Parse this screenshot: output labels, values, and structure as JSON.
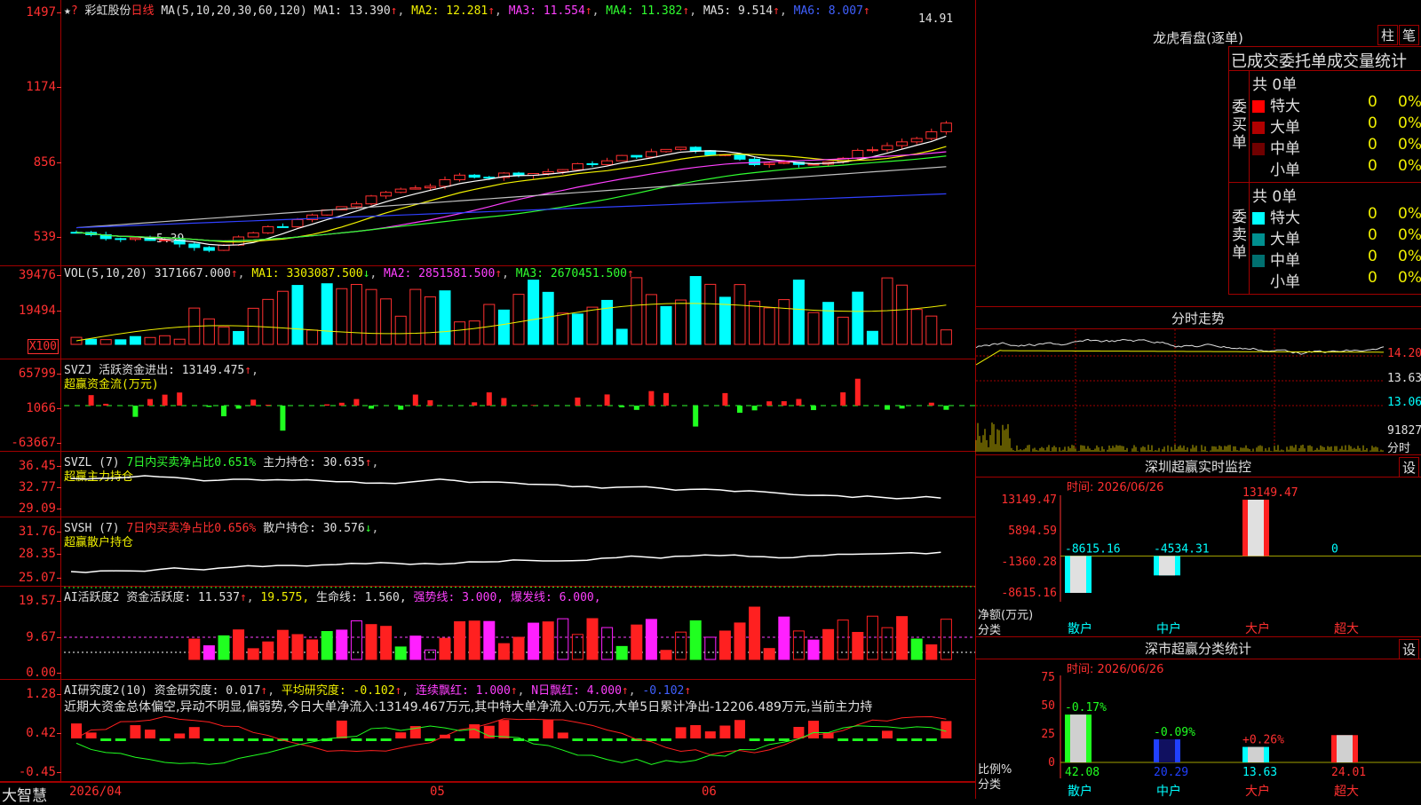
{
  "stock": {
    "name": "彩虹股份",
    "period": "日线",
    "star": "★",
    "mark": "?"
  },
  "ma_line": {
    "label": "MA(5,10,20,30,60,120)",
    "ma1": "MA1: 13.390",
    "ma2": "MA2: 12.281",
    "ma3": "MA3: 11.554",
    "ma4": "MA4: 11.382",
    "ma5": "MA5: 9.514",
    "ma6": "MA6: 8.007",
    "arrow": "↑"
  },
  "price_axis": [
    "1497",
    "1174",
    "856",
    "539"
  ],
  "price_labels": {
    "high": "14.91",
    "low": "5.39"
  },
  "vol": {
    "label": "VOL(5,10,20)",
    "value": "3171667.000",
    "ma1": "MA1: 3303087.500",
    "ma2": "MA2: 2851581.500",
    "ma3": "MA3: 2670451.500",
    "axis": [
      "39476",
      "19494"
    ],
    "unit": "X100"
  },
  "svzj": {
    "label": "SVZJ",
    "title": "活跃资金进出: 13149.475",
    "sub": "超赢资金流(万元)",
    "axis": [
      "65799",
      "1066",
      "-63667"
    ]
  },
  "svzl": {
    "label": "SVZL (7)",
    "p1": "7日内买卖净占比0.651%",
    "p2": "主力持仓: 30.635",
    "sub": "超赢主力持仓",
    "axis": [
      "36.45",
      "32.77",
      "29.09"
    ]
  },
  "svsh": {
    "label": "SVSH (7)",
    "p1": "7日内买卖净占比0.656%",
    "p2": "散户持仓: 30.576",
    "sub": "超赢散户持仓",
    "axis": [
      "31.76",
      "28.35",
      "25.07"
    ]
  },
  "ai1": {
    "label": "AI活跃度2",
    "p1": "资金活跃度: 11.537",
    "p2": "19.575,",
    "p3": "生命线: 1.560,",
    "p4": "强势线: 3.000,",
    "p5": "爆发线: 6.000,",
    "axis": [
      "19.57",
      "9.67",
      "0.00"
    ]
  },
  "ai2": {
    "label": "AI研究度2(10)",
    "p1": "资金研究度: 0.017",
    "p2": "平均研究度: -0.102",
    "p3": "连续飘红: 1.000",
    "p4": "N日飘红: 4.000",
    "p5": "-0.102",
    "text": "近期大资金总体偏空,异动不明显,偏弱势,今日大单净流入:13149.467万元,其中特大单净流入:0万元,大单5日累计净出-12206.489万元,当前主力持",
    "axis": [
      "1.28",
      "0.42",
      "-0.45"
    ]
  },
  "footer": {
    "brand": "大智慧",
    "dates": [
      "2026/04",
      "05",
      "06"
    ]
  },
  "lhb": {
    "title": "龙虎看盘(逐单)",
    "btn1": "柱",
    "btn2": "笔",
    "header": "已成交委托单成交量统计",
    "buy": {
      "side": "委买单",
      "total": "共 0单",
      "rows": [
        {
          "name": "特大",
          "v": "0",
          "p": "0%",
          "color": "#ff0000"
        },
        {
          "name": "大单",
          "v": "0",
          "p": "0%",
          "color": "#b00000"
        },
        {
          "name": "中单",
          "v": "0",
          "p": "0%",
          "color": "#700000"
        },
        {
          "name": "小单",
          "v": "0",
          "p": "0%",
          "color": ""
        }
      ]
    },
    "sell": {
      "side": "委卖单",
      "total": "共 0单",
      "rows": [
        {
          "name": "特大",
          "v": "0",
          "p": "0%",
          "color": "#00ffff"
        },
        {
          "name": "大单",
          "v": "0",
          "p": "0%",
          "color": "#009090"
        },
        {
          "name": "中单",
          "v": "0",
          "p": "0%",
          "color": "#007070"
        },
        {
          "name": "小单",
          "v": "0",
          "p": "0%",
          "color": ""
        }
      ]
    }
  },
  "intraday": {
    "title": "分时走势",
    "axis": [
      "14.20",
      "13.63",
      "13.06"
    ],
    "vol": "91827",
    "unit": "分时"
  },
  "monitor": {
    "title": "深圳超赢实时监控",
    "btn": "设",
    "time": "时间: 2026/06/26",
    "ylabel": "净额(万元)",
    "xlabel": "分类",
    "axis": [
      "13149.47",
      "5894.59",
      "-1360.28",
      "-8615.16"
    ],
    "cats": [
      "散户",
      "中户",
      "大户",
      "超大"
    ],
    "values_text": [
      "-8615.16",
      "-4534.31",
      "13149.47",
      "0"
    ]
  },
  "classify": {
    "title": "深市超赢分类统计",
    "btn": "设",
    "time": "时间: 2026/06/26",
    "ylabel": "比例%",
    "xlabel": "分类",
    "axis": [
      "75",
      "50",
      "25",
      "0"
    ],
    "cats": [
      "散户",
      "中户",
      "大户",
      "超大"
    ],
    "pct": [
      "-0.17%",
      "-0.09%",
      "+0.26%",
      ""
    ],
    "values_text": [
      "42.08",
      "20.29",
      "13.63",
      "24.01"
    ]
  },
  "chart_data": [
    {
      "type": "bar",
      "title": "深圳超赢实时监控",
      "ylabel": "净额(万元)",
      "categories": [
        "散户",
        "中户",
        "大户",
        "超大"
      ],
      "values": [
        -8615.16,
        -4534.31,
        13149.47,
        0
      ],
      "ylim": [
        -8615.16,
        13149.47
      ]
    },
    {
      "type": "bar",
      "title": "深市超赢分类统计",
      "ylabel": "比例%",
      "categories": [
        "散户",
        "中户",
        "大户",
        "超大"
      ],
      "values": [
        42.08,
        20.29,
        13.63,
        24.01
      ],
      "ylim": [
        0,
        75
      ]
    },
    {
      "type": "line",
      "x": [
        "2026/04",
        "05",
        "06"
      ],
      "ylim": [
        539,
        1497
      ],
      "price_high": 14.91,
      "price_low": 5.39
    }
  ]
}
